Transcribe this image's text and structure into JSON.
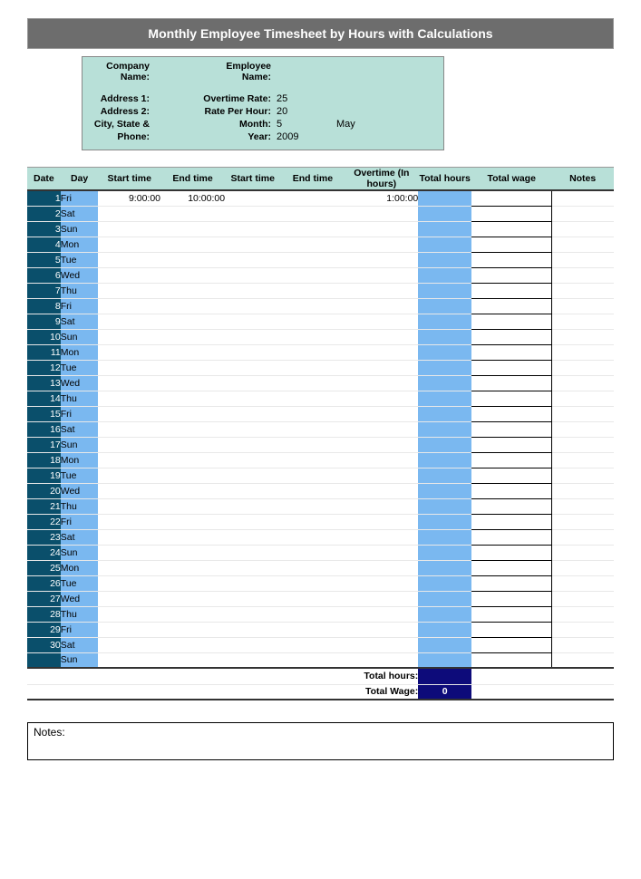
{
  "title": "Monthly Employee Timesheet by Hours with Calculations",
  "info": {
    "companyLabel": "Company Name:",
    "companyValue": "",
    "employeeLabel": "Employee Name:",
    "employeeValue": "",
    "address1Label": "Address 1:",
    "address2Label": "Address 2:",
    "cityLabel": "City, State &",
    "phoneLabel": "Phone:",
    "overtimeLabel": "Overtime Rate:",
    "overtimeValue": "25",
    "ratePerHourLabel": "Rate Per Hour:",
    "ratePerHourValue": "20",
    "monthLabel": "Month:",
    "monthValue": "5",
    "monthName": "May",
    "yearLabel": "Year:",
    "yearValue": "2009"
  },
  "headers": {
    "date": "Date",
    "day": "Day",
    "start1": "Start time",
    "end1": "End time",
    "start2": "Start time",
    "end2": "End time",
    "overtime": "Overtime (In hours)",
    "totalHours": "Total hours",
    "totalWage": "Total wage",
    "notes": "Notes"
  },
  "rows": [
    {
      "date": "1",
      "day": "Fri",
      "start1": "9:00:00",
      "end1": "10:00:00",
      "start2": "",
      "end2": "",
      "overtime": "1:00:00"
    },
    {
      "date": "2",
      "day": "Sat"
    },
    {
      "date": "3",
      "day": "Sun"
    },
    {
      "date": "4",
      "day": "Mon"
    },
    {
      "date": "5",
      "day": "Tue"
    },
    {
      "date": "6",
      "day": "Wed"
    },
    {
      "date": "7",
      "day": "Thu"
    },
    {
      "date": "8",
      "day": "Fri"
    },
    {
      "date": "9",
      "day": "Sat"
    },
    {
      "date": "10",
      "day": "Sun"
    },
    {
      "date": "11",
      "day": "Mon"
    },
    {
      "date": "12",
      "day": "Tue"
    },
    {
      "date": "13",
      "day": "Wed"
    },
    {
      "date": "14",
      "day": "Thu"
    },
    {
      "date": "15",
      "day": "Fri"
    },
    {
      "date": "16",
      "day": "Sat"
    },
    {
      "date": "17",
      "day": "Sun"
    },
    {
      "date": "18",
      "day": "Mon"
    },
    {
      "date": "19",
      "day": "Tue"
    },
    {
      "date": "20",
      "day": "Wed"
    },
    {
      "date": "21",
      "day": "Thu"
    },
    {
      "date": "22",
      "day": "Fri"
    },
    {
      "date": "23",
      "day": "Sat"
    },
    {
      "date": "24",
      "day": "Sun"
    },
    {
      "date": "25",
      "day": "Mon"
    },
    {
      "date": "26",
      "day": "Tue"
    },
    {
      "date": "27",
      "day": "Wed"
    },
    {
      "date": "28",
      "day": "Thu"
    },
    {
      "date": "29",
      "day": "Fri"
    },
    {
      "date": "30",
      "day": "Sat"
    },
    {
      "date": "",
      "day": "Sun"
    }
  ],
  "totals": {
    "hoursLabel": "Total hours:",
    "hoursValue": "",
    "wageLabel": "Total Wage:",
    "wageValue": "0"
  },
  "notesLabel": "Notes:"
}
